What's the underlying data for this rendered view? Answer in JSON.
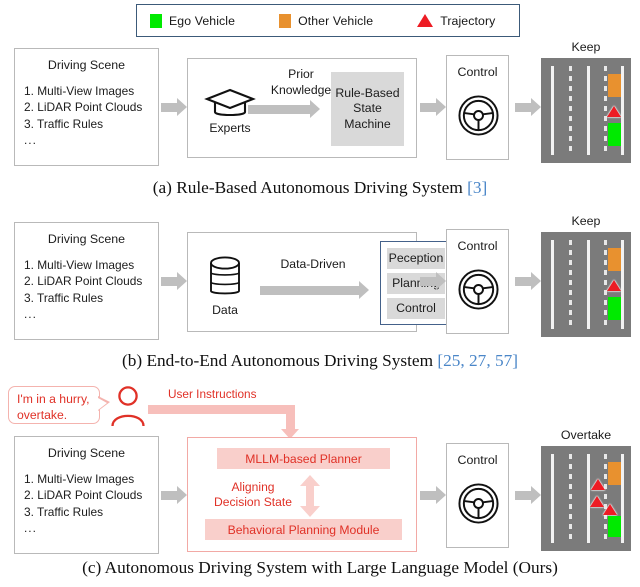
{
  "legend": {
    "items": [
      {
        "label": "Ego Vehicle",
        "icon": "green-square-swatch",
        "color": "#00ea00"
      },
      {
        "label": "Other Vehicle",
        "icon": "orange-square-swatch",
        "color": "#e8912f"
      },
      {
        "label": "Trajectory",
        "icon": "red-triangle-swatch",
        "color": "#ed1c24"
      }
    ]
  },
  "scene": {
    "title": "Driving Scene",
    "items": [
      "1. Multi-View Images",
      "2. LiDAR Point Clouds",
      "3. Traffic Rules",
      "..."
    ]
  },
  "row_a": {
    "expert_label": "Experts",
    "arrow_label_line1": "Prior",
    "arrow_label_line2": "Knowledge",
    "module_line1": "Rule-Based",
    "module_line2": "State",
    "module_line3": "Machine",
    "control_label": "Control",
    "road_caption": "Keep",
    "caption_text": "(a) Rule-Based Autonomous Driving System ",
    "caption_cite": "[3]"
  },
  "row_b": {
    "data_label": "Data",
    "arrow_label": "Data-Driven",
    "stack": [
      "Peception",
      "Planning",
      "Control"
    ],
    "control_label": "Control",
    "road_caption": "Keep",
    "caption_text": "(b) End-to-End Autonomous Driving System ",
    "caption_cite": "[25, 27, 57]"
  },
  "row_c": {
    "bubble_line1": "I'm in a hurry,",
    "bubble_line2": "overtake.",
    "user_instructions_label": "User Instructions",
    "planner_label": "MLLM-based Planner",
    "align_line1": "Aligning",
    "align_line2": "Decision State",
    "behavior_label": "Behavioral Planning Module",
    "control_label": "Control",
    "road_caption": "Overtake",
    "caption_text": "(c) Autonomous Driving System with Large Language Model (Ours)",
    "caption_cite": ""
  },
  "colors": {
    "ego": "#00ea00",
    "other": "#e8912f",
    "trajectory": "#ed1c24",
    "road": "#7b7b7b",
    "accent_pink": "#f9cfcb",
    "accent_red": "#e03127",
    "legend_border": "#3c5a79",
    "stack_border": "#44618a",
    "arrow_grey": "#bfbfbf",
    "cite_blue": "#4a86c8"
  },
  "scenes": {
    "keep": {
      "lanes": [
        "solid",
        "dashed",
        "solid",
        "dashed",
        "solid"
      ],
      "ego_lane": 4,
      "other_lane": 4,
      "trajectory_count": 1
    },
    "overtake": {
      "lanes": [
        "solid",
        "dashed",
        "solid",
        "dashed",
        "solid"
      ],
      "ego_lane": 4,
      "other_lane": 4,
      "trajectory_count": 3
    }
  }
}
